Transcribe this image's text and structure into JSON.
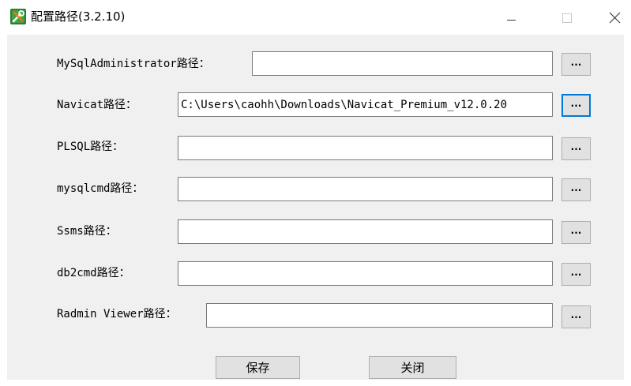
{
  "window": {
    "title": "配置路径(3.2.10)",
    "controls": {
      "minimize": "minimize-icon",
      "maximize": "maximize-icon",
      "close": "close-icon"
    }
  },
  "fields": [
    {
      "label": "MySqlAdministrator路径：",
      "value": "",
      "button": "···"
    },
    {
      "label": "Navicat路径：",
      "value": "C:\\Users\\caohh\\Downloads\\Navicat_Premium_v12.0.20",
      "button": "···"
    },
    {
      "label": "PLSQL路径：",
      "value": "",
      "button": "···"
    },
    {
      "label": "mysqlcmd路径：",
      "value": "",
      "button": "···"
    },
    {
      "label": "Ssms路径：",
      "value": "",
      "button": "···"
    },
    {
      "label": "db2cmd路径：",
      "value": "",
      "button": "···"
    },
    {
      "label": "Radmin Viewer路径：",
      "value": "",
      "button": "···"
    }
  ],
  "buttons": {
    "save": "保存",
    "close": "关闭"
  },
  "colors": {
    "client_bg": "#f0f0f0",
    "focus_border": "#0078d7"
  }
}
